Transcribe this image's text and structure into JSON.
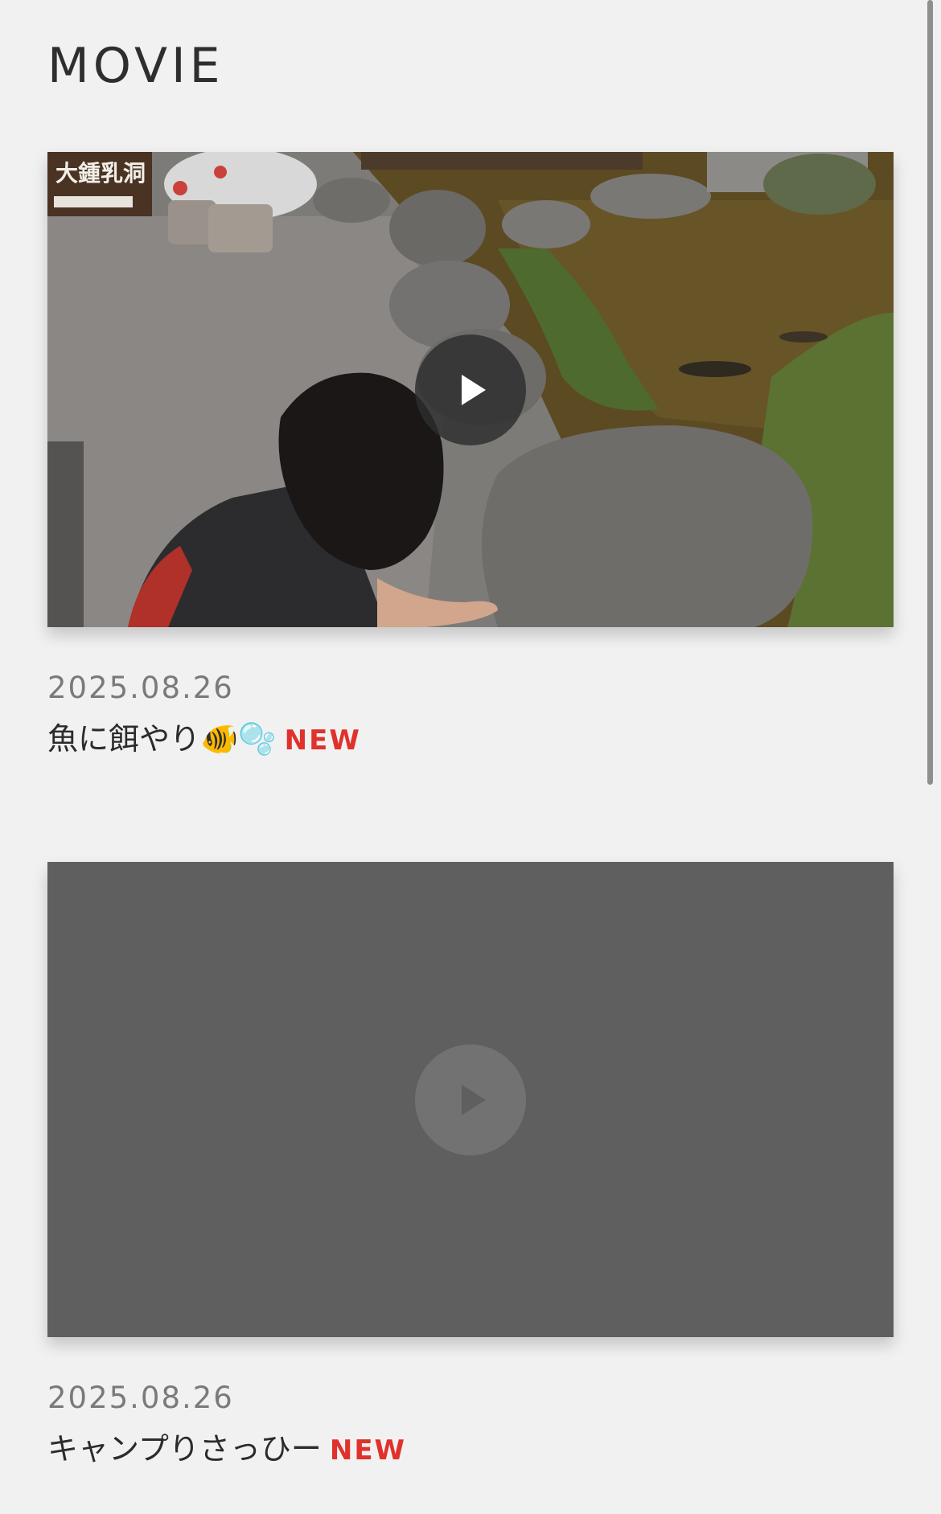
{
  "page": {
    "title": "MOVIE"
  },
  "movies": [
    {
      "date": "2025.08.26",
      "title": "魚に餌やり🐠🫧",
      "badge": "NEW",
      "thumbnail": "photo",
      "sign_text": "大鍾乳洞"
    },
    {
      "date": "2025.08.26",
      "title": "キャンプりさっひー",
      "badge": "NEW",
      "thumbnail": "placeholder"
    }
  ],
  "colors": {
    "background": "#f1f1f1",
    "badge": "#e0312b",
    "placeholder": "#5f5f5f"
  },
  "icons": {
    "play": "play-icon"
  }
}
